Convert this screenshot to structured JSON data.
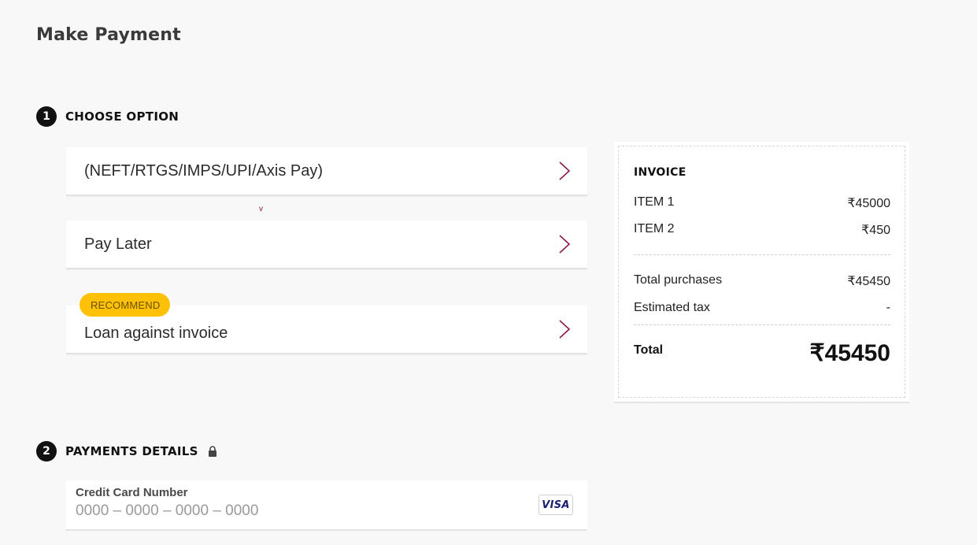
{
  "page": {
    "title": "Make Payment"
  },
  "step1": {
    "number": "1",
    "label": "CHOOSE OPTION"
  },
  "options": [
    {
      "label": "(NEFT/RTGS/IMPS/UPI/Axis Pay)"
    },
    {
      "label": "Pay Later"
    },
    {
      "label": "Loan against invoice",
      "badge": "RECOMMEND"
    }
  ],
  "misc": {
    "small_chevron": "v"
  },
  "invoice": {
    "title": "INVOICE",
    "items": [
      {
        "label": "ITEM 1",
        "value": "₹45000"
      },
      {
        "label": "ITEM 2",
        "value": "₹450"
      }
    ],
    "total_purchases": {
      "label": "Total purchases",
      "value": "₹45450"
    },
    "estimated_tax": {
      "label": "Estimated tax",
      "value": "-"
    },
    "total": {
      "label": "Total",
      "value": "₹45450"
    }
  },
  "step2": {
    "number": "2",
    "label": "PAYMENTS DETAILS"
  },
  "card": {
    "label": "Credit Card Number",
    "placeholder": "0000 – 0000 – 0000 – 0000",
    "brand": "VISA"
  },
  "colors": {
    "accent": "#8a1a4a",
    "badge": "#ffc107",
    "visa_blue": "#1a1f71"
  }
}
